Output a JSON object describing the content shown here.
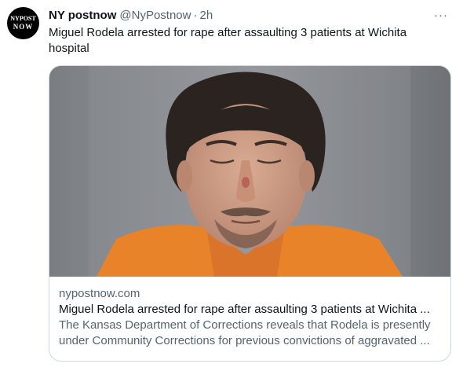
{
  "author": {
    "avatar_line1": "NYPOST",
    "avatar_line2": "NOW",
    "name": "NY postnow",
    "handle": "@NyPostnow",
    "separator": "·",
    "time": "2h"
  },
  "more_label": "···",
  "tweet": {
    "text": "Miguel Rodela arrested for rape after assaulting 3 patients at Wichita hospital"
  },
  "card": {
    "domain": "nypostnow.com",
    "title": "Miguel Rodela arrested for rape after assaulting 3 patients at Wichita ...",
    "description": "The Kansas Department of Corrections reveals that Rodela is presently under Community Corrections for previous convictions of aggravated ..."
  },
  "colors": {
    "text_primary": "#0f1419",
    "text_secondary": "#536471",
    "border": "#cfd9de",
    "shirt_orange": "#e8832a"
  }
}
